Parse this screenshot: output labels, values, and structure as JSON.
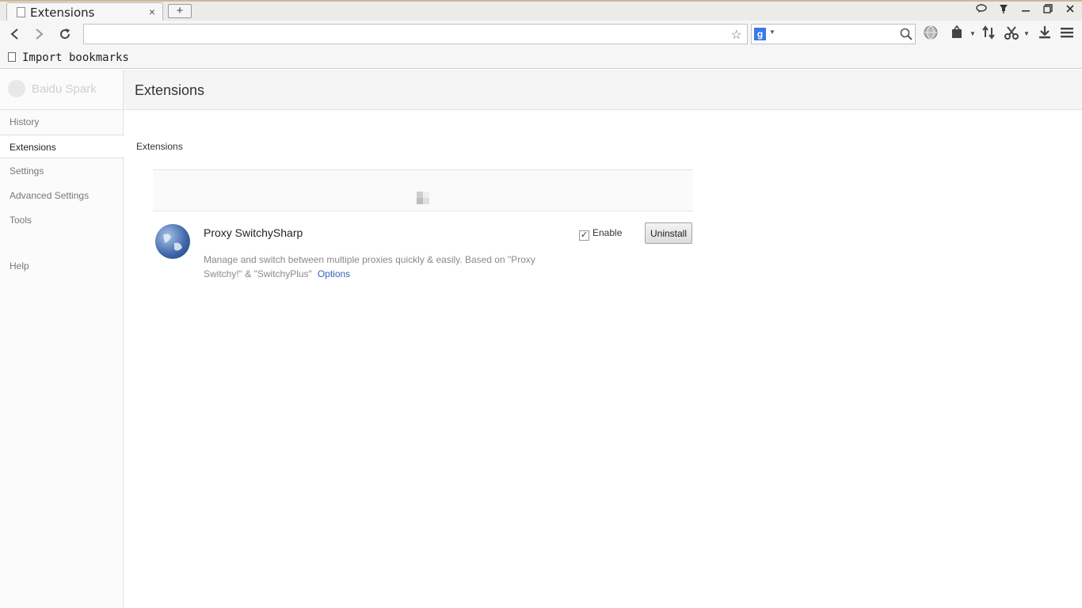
{
  "tab": {
    "title": "Extensions",
    "close": "×"
  },
  "window": {
    "new_tab": "+"
  },
  "bookmarks": {
    "import_label": "Import bookmarks"
  },
  "search": {
    "engine": "g"
  },
  "sidebar": {
    "brand": "Baidu Spark",
    "items": [
      {
        "label": "History"
      },
      {
        "label": "Extensions",
        "active": true
      },
      {
        "label": "Settings"
      },
      {
        "label": "Advanced Settings"
      },
      {
        "label": "Tools"
      },
      {
        "label": "Help"
      }
    ]
  },
  "page": {
    "title": "Extensions",
    "section_title": "Extensions"
  },
  "extension": {
    "name": "Proxy SwitchySharp",
    "description": "Manage and switch between multiple proxies quickly & easily. Based on \"Proxy Switchy!\" & \"SwitchyPlus\"",
    "options_label": "Options",
    "enable_label": "Enable",
    "enabled": true,
    "uninstall_label": "Uninstall"
  },
  "colors": {
    "accent_link": "#2f63b5",
    "search_logo": "#3b78e7",
    "tab_top_border": "#c8b99a"
  }
}
